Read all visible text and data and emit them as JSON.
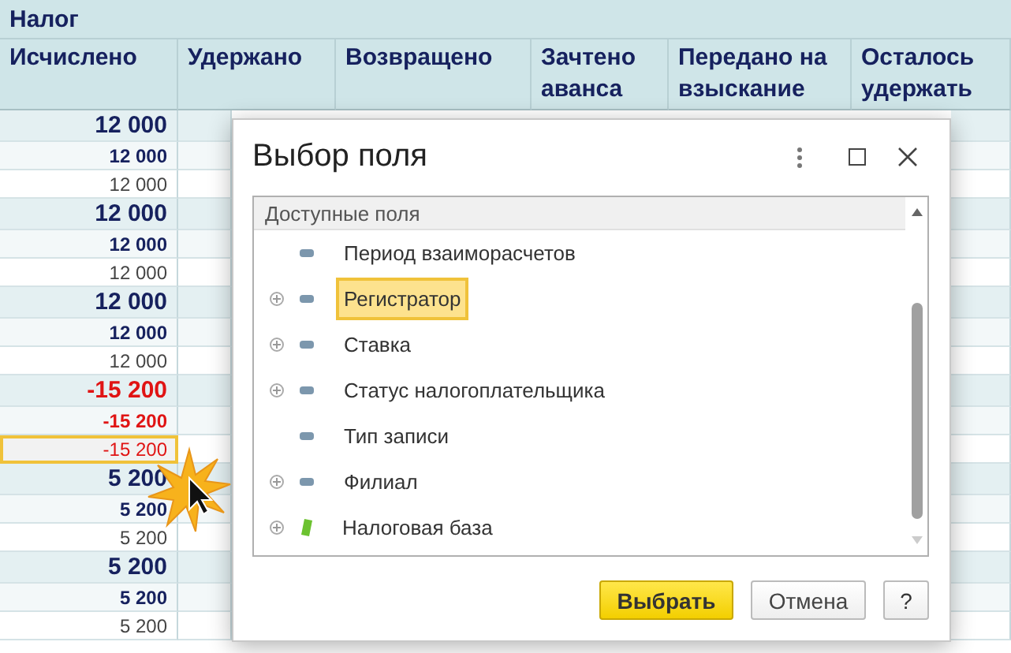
{
  "table": {
    "group_header": "Налог",
    "columns": [
      "Исчислено",
      "Удержано",
      "Возвращено",
      "Зачтено аванса",
      "Передано на взыскание",
      "Осталось удержать"
    ],
    "rows": [
      {
        "kind": "total",
        "value": "12 000",
        "negative": false,
        "selected": false
      },
      {
        "kind": "sub",
        "value": "12 000",
        "negative": false,
        "selected": false
      },
      {
        "kind": "detail",
        "value": "12 000",
        "negative": false,
        "selected": false
      },
      {
        "kind": "total",
        "value": "12 000",
        "negative": false,
        "selected": false
      },
      {
        "kind": "sub",
        "value": "12 000",
        "negative": false,
        "selected": false
      },
      {
        "kind": "detail",
        "value": "12 000",
        "negative": false,
        "selected": false
      },
      {
        "kind": "total",
        "value": "12 000",
        "negative": false,
        "selected": false
      },
      {
        "kind": "sub",
        "value": "12 000",
        "negative": false,
        "selected": false
      },
      {
        "kind": "detail",
        "value": "12 000",
        "negative": false,
        "selected": false
      },
      {
        "kind": "total",
        "value": "-15 200",
        "negative": true,
        "selected": false
      },
      {
        "kind": "sub",
        "value": "-15 200",
        "negative": true,
        "selected": false
      },
      {
        "kind": "detail",
        "value": "-15 200",
        "negative": true,
        "selected": true
      },
      {
        "kind": "total",
        "value": "5 200",
        "negative": false,
        "selected": false
      },
      {
        "kind": "sub",
        "value": "5 200",
        "negative": false,
        "selected": false
      },
      {
        "kind": "detail",
        "value": "5 200",
        "negative": false,
        "selected": false
      },
      {
        "kind": "total",
        "value": "5 200",
        "negative": false,
        "selected": false
      },
      {
        "kind": "sub",
        "value": "5 200",
        "negative": false,
        "selected": false
      },
      {
        "kind": "detail",
        "value": "5 200",
        "negative": false,
        "selected": false
      }
    ]
  },
  "dialog": {
    "title": "Выбор поля",
    "tree": {
      "header": "Доступные поля",
      "items": [
        {
          "label": "Период взаиморасчетов",
          "kind": "field",
          "expandable": false,
          "selected": false
        },
        {
          "label": "Регистратор",
          "kind": "field",
          "expandable": true,
          "selected": true
        },
        {
          "label": "Ставка",
          "kind": "field",
          "expandable": true,
          "selected": false
        },
        {
          "label": "Статус налогоплательщика",
          "kind": "field",
          "expandable": true,
          "selected": false
        },
        {
          "label": "Тип записи",
          "kind": "field",
          "expandable": false,
          "selected": false
        },
        {
          "label": "Филиал",
          "kind": "field",
          "expandable": true,
          "selected": false
        },
        {
          "label": "Налоговая база",
          "kind": "measure",
          "expandable": true,
          "selected": false
        }
      ]
    },
    "buttons": [
      {
        "label": "Выбрать",
        "kind": "primary"
      },
      {
        "label": "Отмена",
        "kind": "normal"
      },
      {
        "label": "?",
        "kind": "help"
      }
    ]
  }
}
